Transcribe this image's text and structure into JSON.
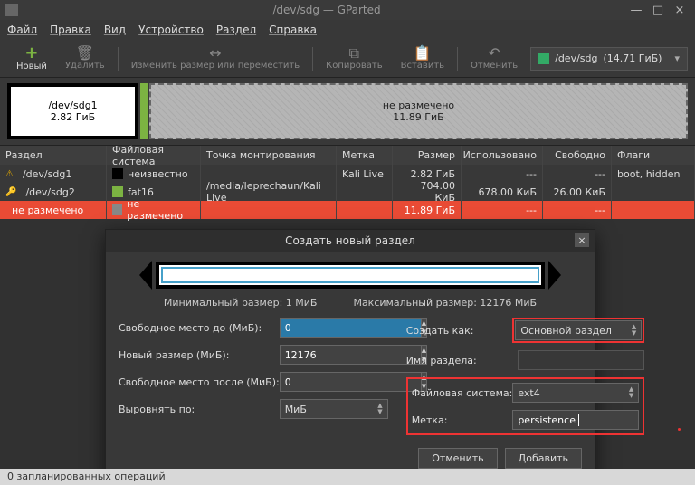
{
  "window": {
    "title": "/dev/sdg — GParted",
    "min": "—",
    "max": "□",
    "close": "×"
  },
  "menu": {
    "file": "Файл",
    "edit": "Правка",
    "view": "Вид",
    "device": "Устройство",
    "partition": "Раздел",
    "help": "Справка"
  },
  "toolbar": {
    "new": "Новый",
    "delete": "Удалить",
    "resize": "Изменить размер или переместить",
    "copy": "Копировать",
    "paste": "Вставить",
    "undo": "Отменить",
    "device": "/dev/sdg",
    "device_size": "(14.71 ГиБ)"
  },
  "vis": {
    "p1_name": "/dev/sdg1",
    "p1_size": "2.82 ГиБ",
    "unalloc_label": "не размечено",
    "unalloc_size": "11.89 ГиБ"
  },
  "columns": {
    "partition": "Раздел",
    "fs": "Файловая система",
    "mount": "Точка монтирования",
    "label": "Метка",
    "size": "Размер",
    "used": "Использовано",
    "free": "Свободно",
    "flags": "Флаги"
  },
  "rows": [
    {
      "part": "/dev/sdg1",
      "fs": "неизвестно",
      "mount": "",
      "label": "Kali Live",
      "size": "2.82 ГиБ",
      "used": "---",
      "free": "---",
      "flags": "boot, hidden",
      "sq": "black",
      "warn": true
    },
    {
      "part": "/dev/sdg2",
      "fs": "fat16",
      "mount": "/media/leprechaun/Kali Live",
      "label": "",
      "size": "704.00 КиБ",
      "used": "678.00 КиБ",
      "free": "26.00 КиБ",
      "flags": "",
      "sq": "green",
      "key": true
    },
    {
      "part": "не размечено",
      "fs": "не размечено",
      "mount": "",
      "label": "",
      "size": "11.89 ГиБ",
      "used": "---",
      "free": "---",
      "flags": "",
      "sq": "grey",
      "sel": true
    }
  ],
  "dialog": {
    "title": "Создать новый раздел",
    "min_label": "Минимальный размер: 1 МиБ",
    "max_label": "Максимальный размер: 12176 МиБ",
    "free_before_label": "Свободное место до (МиБ):",
    "free_before_value": "0",
    "new_size_label": "Новый размер (МиБ):",
    "new_size_value": "12176",
    "free_after_label": "Свободное место после (МиБ):",
    "free_after_value": "0",
    "align_label": "Выровнять по:",
    "align_value": "МиБ",
    "create_as_label": "Создать как:",
    "create_as_value": "Основной раздел",
    "name_label": "Имя раздела:",
    "name_value": "",
    "fs_label": "Файловая система:",
    "fs_value": "ext4",
    "metka_label": "Метка:",
    "metka_value": "persistence",
    "cancel": "Отменить",
    "add": "Добавить"
  },
  "statusbar": "0 запланированных операций"
}
